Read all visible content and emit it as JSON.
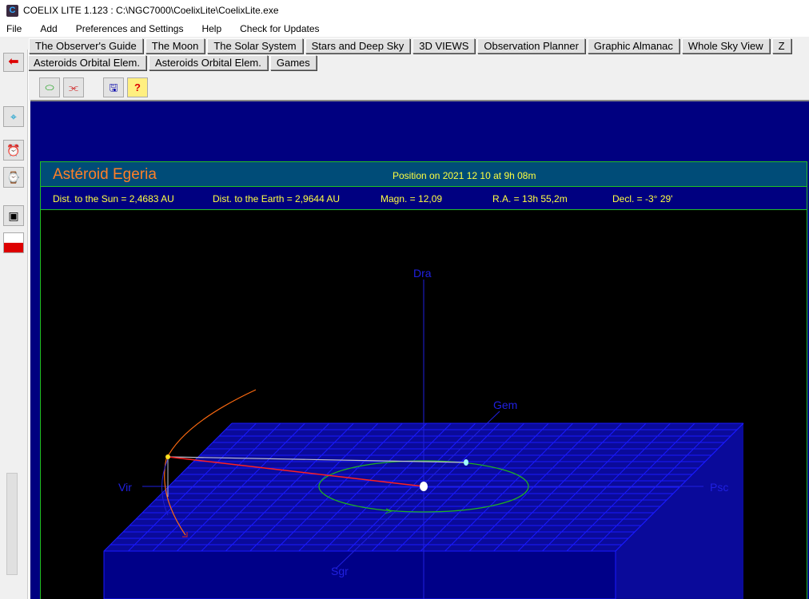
{
  "window": {
    "title": "COELIX LITE 1.123 : C:\\NGC7000\\CoelixLite\\CoelixLite.exe"
  },
  "menu": [
    "File",
    "Add",
    "Preferences and Settings",
    "Help",
    "Check for Updates"
  ],
  "tabs_row1": [
    "The Observer's Guide",
    "The Moon",
    "The Solar System",
    "Stars and Deep Sky",
    "3D VIEWS",
    "Observation Planner",
    "Graphic Almanac",
    "Whole Sky View",
    "Z"
  ],
  "tabs_row2": [
    "Asteroids Orbital Elem.",
    "Asteroids Orbital Elem.",
    "Games"
  ],
  "toolbar": {
    "help_label": "?"
  },
  "panel": {
    "title": "Astéroid Egeria",
    "position": "Position on 2021 12 10 at 9h 08m",
    "info": [
      "Dist. to the Sun = 2,4683 AU",
      "Dist. to the Earth = 2,9644 AU",
      "Magn. = 12,09",
      "R.A. = 13h 55,2m",
      "Decl. = -3° 29'"
    ]
  },
  "scene": {
    "labels": {
      "north": "Dra",
      "back": "Gem",
      "left": "Vir",
      "right": "Psc",
      "front": "Sgr"
    },
    "colors": {
      "grid": "#1a1aff",
      "plane": "#0a0a9a",
      "earth_orbit": "#20b020",
      "asteroid_orbit": "#ff6a10",
      "sun_line": "#ff2020",
      "earth_line": "#c0c0d0"
    }
  }
}
